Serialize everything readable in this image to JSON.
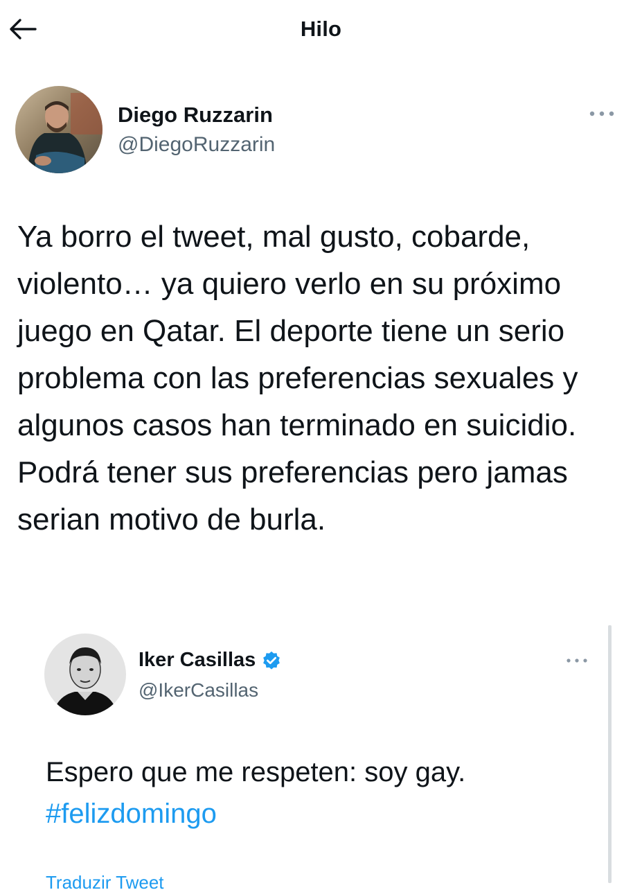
{
  "header": {
    "title": "Hilo",
    "back_icon": "arrow-left-icon"
  },
  "tweet": {
    "author_name": "Diego Ruzzarin",
    "author_handle": "@DiegoRuzzarin",
    "more_icon": "more-horizontal-icon",
    "text": "Ya borro el tweet, mal gusto, cobarde, violento… ya quiero verlo en su próximo juego en Qatar. El deporte tiene un serio problema con las preferencias sexuales y algunos casos han terminado en suicidio. Podrá tener sus preferencias pero jamas serian motivo de burla."
  },
  "quoted_tweet": {
    "author_name": "Iker Casillas",
    "author_handle": "@IkerCasillas",
    "verified_icon": "verified-badge-icon",
    "more_icon": "more-horizontal-icon",
    "text": "Espero que me respeten: soy gay.",
    "hashtag": "#felizdomingo",
    "translate_label": "Traduzir Tweet"
  },
  "colors": {
    "text": "#0f1419",
    "secondary": "#536471",
    "accent": "#1d9bf0",
    "divider": "#d9dde0"
  }
}
